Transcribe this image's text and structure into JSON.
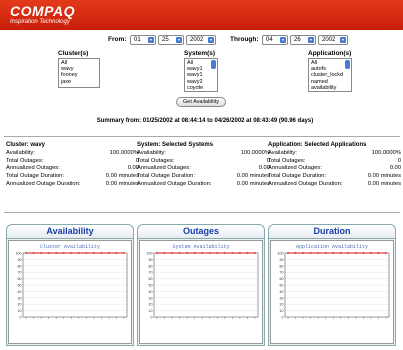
{
  "header": {
    "brand": "COMPAQ",
    "tagline": "Inspiration Technology",
    "color": "#d42a12"
  },
  "date_range": {
    "from_label": "From:",
    "through_label": "Through:",
    "from": {
      "month": "01",
      "day": "25",
      "year": "2002"
    },
    "through": {
      "month": "04",
      "day": "26",
      "year": "2002"
    }
  },
  "selectors": {
    "cluster": {
      "label": "Cluster(s)",
      "options": [
        "All",
        "wavy",
        "fooney",
        "jaxe"
      ]
    },
    "system": {
      "label": "System(s)",
      "options": [
        "All",
        "wavy1",
        "wavy1",
        "wavy2",
        "coyote"
      ]
    },
    "application": {
      "label": "Application(s)",
      "options": [
        "All",
        "autofs",
        "cluster_lockd",
        "named",
        "availability"
      ]
    }
  },
  "get_button": "Get Availability",
  "summary": "Summary from: 01/25/2002 at 08:44:14 to 04/26/2002 at 08:43:49 (90.96 days)",
  "stats": [
    {
      "title": "Cluster: wavy",
      "rows": [
        {
          "label": "Availability:",
          "value": "100.0000%"
        },
        {
          "label": "Total Outages:",
          "value": "0"
        },
        {
          "label": "Annualized Outages:",
          "value": "0.00"
        },
        {
          "label": "Total Outage Duration:",
          "value": "0.00 minutes"
        },
        {
          "label": "Annualized Outage Duration:",
          "value": "0.00 minutes"
        }
      ]
    },
    {
      "title": "System: Selected Systems",
      "rows": [
        {
          "label": "Availability:",
          "value": "100.0000%"
        },
        {
          "label": "Total Outages:",
          "value": "0"
        },
        {
          "label": "Annualized Outages:",
          "value": "0.00"
        },
        {
          "label": "Total Outage Duration:",
          "value": "0.00 minutes"
        },
        {
          "label": "Annualized Outage Duration:",
          "value": "0.00 minutes"
        }
      ]
    },
    {
      "title": "Application: Selected Applications",
      "rows": [
        {
          "label": "Availability:",
          "value": "100.0000%"
        },
        {
          "label": "Total Outages:",
          "value": "0"
        },
        {
          "label": "Annualized Outages:",
          "value": "0.00"
        },
        {
          "label": "Total Outage Duration:",
          "value": "0.00 minutes"
        },
        {
          "label": "Annualized Outage Duration:",
          "value": "0.00 minutes"
        }
      ]
    }
  ],
  "tabs": [
    "Availability",
    "Outages",
    "Duration"
  ],
  "chart_data": [
    {
      "type": "line",
      "title": "Cluster Availability",
      "yticks": [
        "100",
        "90",
        "80",
        "70",
        "60",
        "50",
        "40",
        "30",
        "20",
        "10",
        "0"
      ],
      "ylim": [
        0,
        100
      ],
      "series": [
        {
          "values": [
            100,
            100,
            100,
            100,
            100,
            100,
            100,
            100,
            100,
            100,
            100,
            100,
            100,
            100
          ]
        }
      ]
    },
    {
      "type": "line",
      "title": "System Availability",
      "yticks": [
        "100",
        "90",
        "80",
        "70",
        "60",
        "50",
        "40",
        "30",
        "20",
        "10",
        "0"
      ],
      "ylim": [
        0,
        100
      ],
      "series": [
        {
          "values": [
            100,
            100,
            100,
            100,
            100,
            100,
            100,
            100,
            100,
            100,
            100,
            100,
            100,
            100
          ]
        }
      ]
    },
    {
      "type": "line",
      "title": "Application Availability",
      "yticks": [
        "100",
        "90",
        "80",
        "70",
        "60",
        "50",
        "40",
        "30",
        "20",
        "10",
        "0"
      ],
      "ylim": [
        0,
        100
      ],
      "series": [
        {
          "values": [
            100,
            100,
            100,
            100,
            100,
            100,
            100,
            100,
            100,
            100,
            100,
            100,
            100,
            100
          ]
        }
      ]
    }
  ]
}
